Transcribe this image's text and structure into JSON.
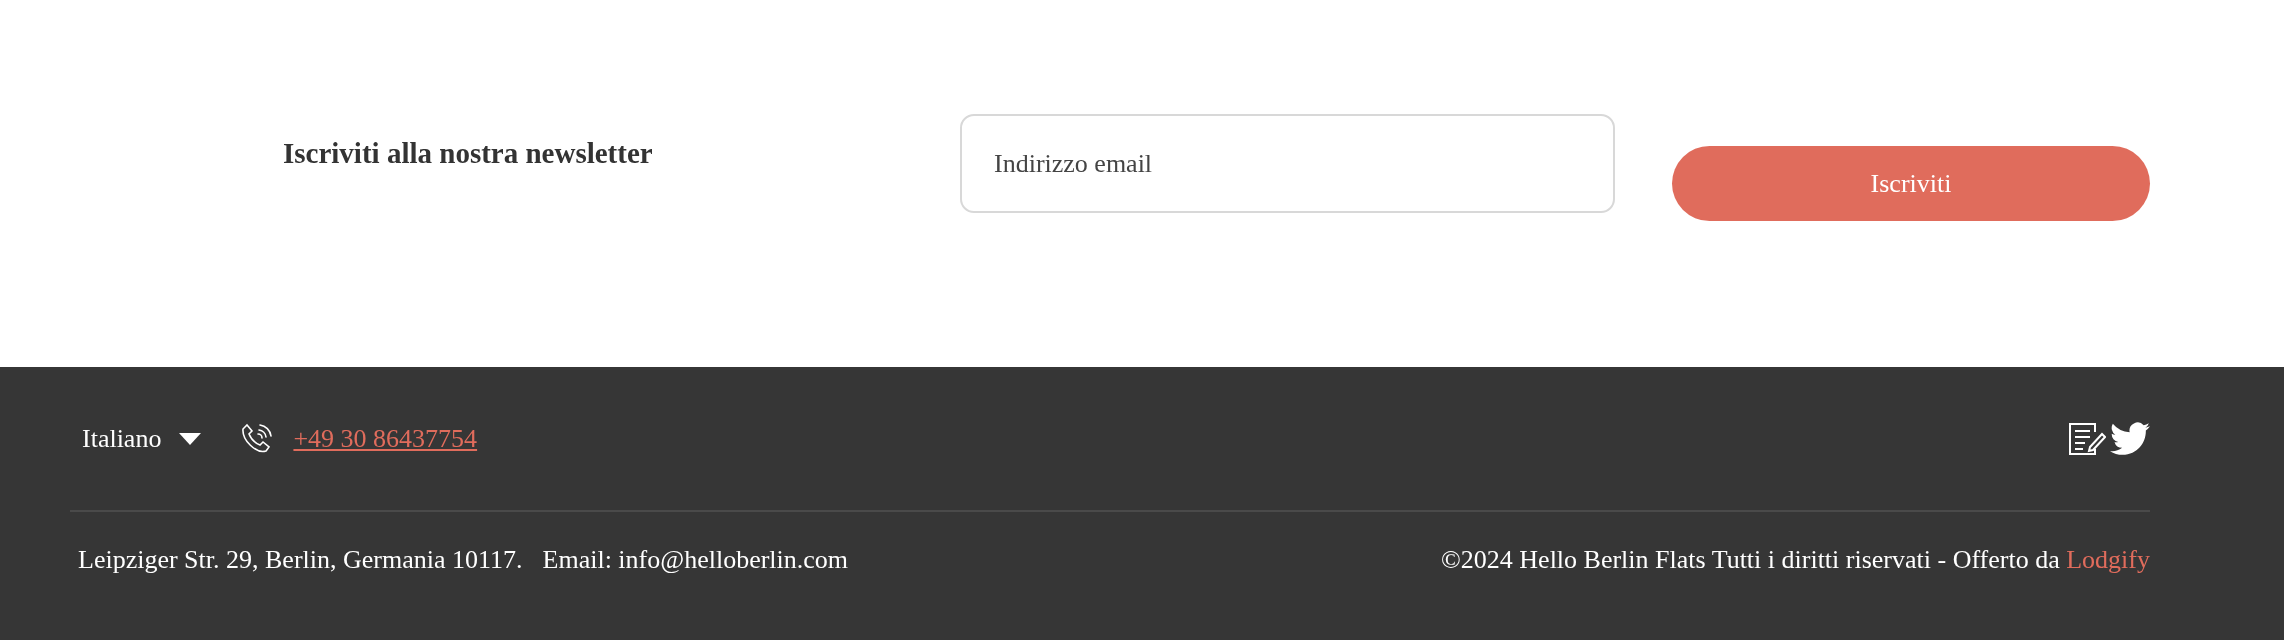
{
  "newsletter": {
    "title": "Iscriviti alla nostra newsletter",
    "email_field": {
      "placeholder": "Indirizzo email"
    },
    "button": "Iscriviti"
  },
  "footer": {
    "language": "Italiano",
    "phone": "+49 30 86437754",
    "address": "Leipziger Str. 29, Berlin, Germania 10117.",
    "email": "Email: info@helloberlin.com",
    "copyright": "©2024 Hello Berlin Flats Tutti i diritti riservati - Offerto da",
    "provider_link": "Lodgify"
  }
}
